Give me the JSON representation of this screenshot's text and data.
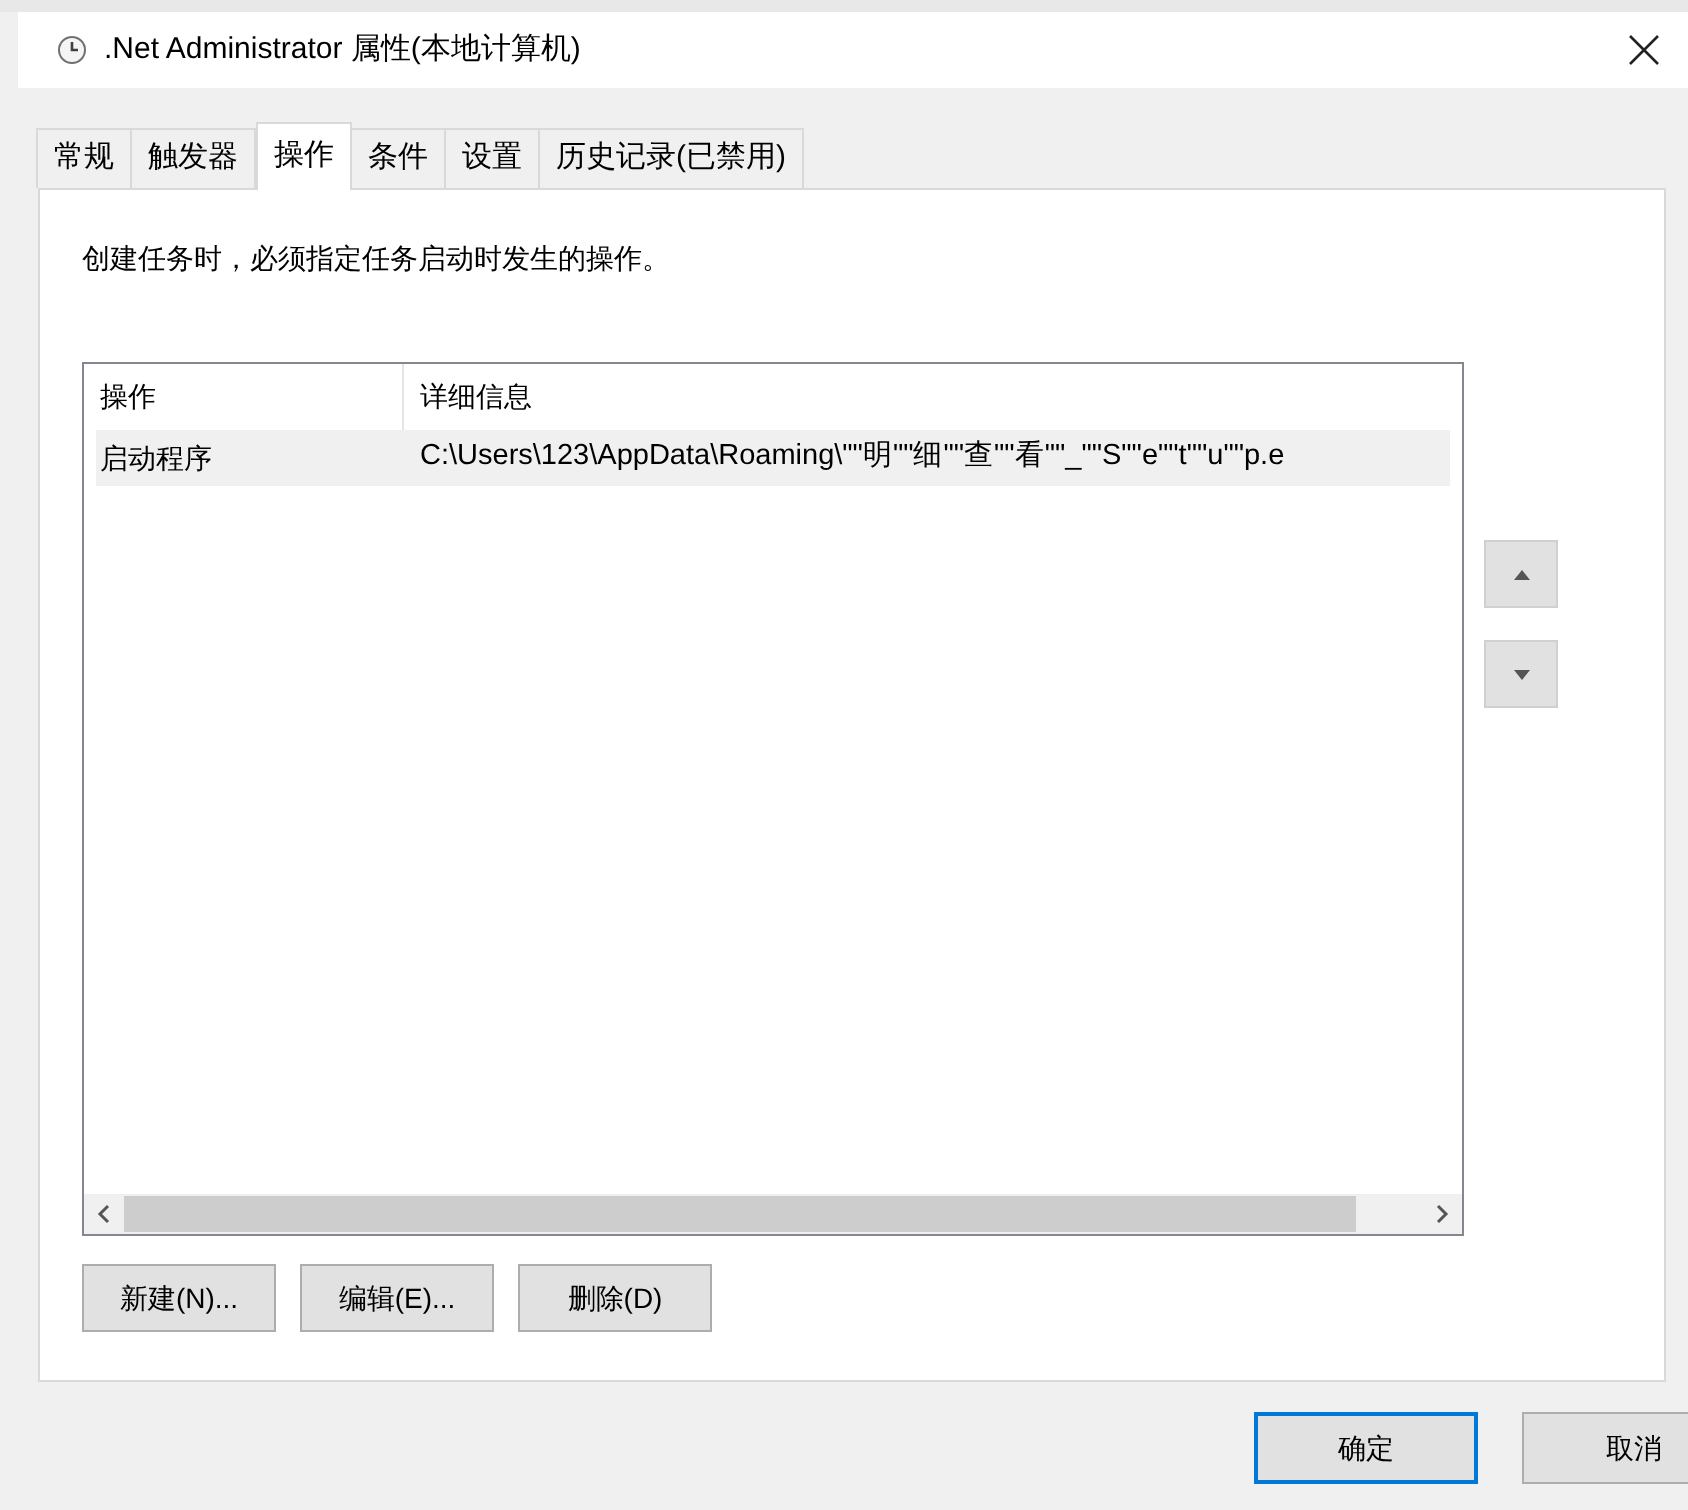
{
  "window": {
    "title": ".Net Administrator 属性(本地计算机)"
  },
  "tabs": [
    {
      "label": "常规",
      "selected": false
    },
    {
      "label": "触发器",
      "selected": false
    },
    {
      "label": "操作",
      "selected": true
    },
    {
      "label": "条件",
      "selected": false
    },
    {
      "label": "设置",
      "selected": false
    },
    {
      "label": "历史记录(已禁用)",
      "selected": false
    }
  ],
  "description": "创建任务时，必须指定任务启动时发生的操作。",
  "table": {
    "columns": [
      "操作",
      "详细信息"
    ],
    "rows": [
      {
        "cells": [
          "启动程序",
          "C:\\Users\\123\\AppData\\Roaming\\\"\"明\"\"细\"\"查\"\"看\"\"_\"\"S\"\"e\"\"t\"\"u\"\"p.e"
        ],
        "selected": true
      }
    ]
  },
  "actions": [
    "新建(N)...",
    "编辑(E)...",
    "删除(D)"
  ],
  "footer_buttons": [
    {
      "label": "确定",
      "default": true
    },
    {
      "label": "取消",
      "default": false
    }
  ]
}
